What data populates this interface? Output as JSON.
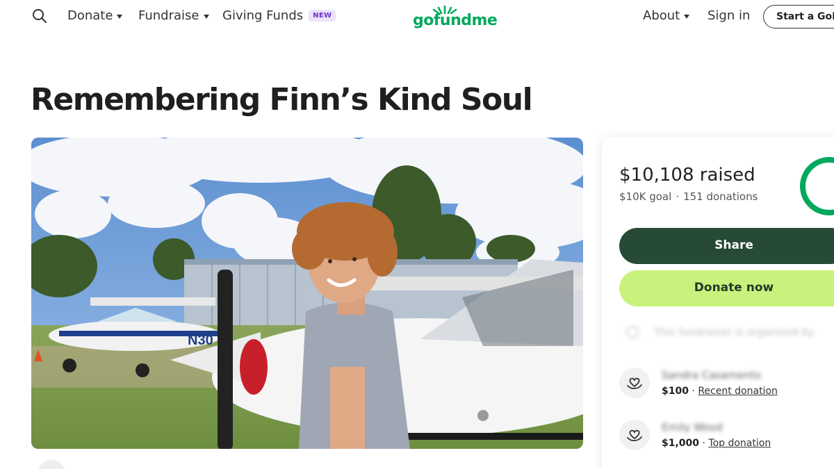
{
  "nav": {
    "donate": "Donate",
    "fundraise": "Fundraise",
    "giving_funds": "Giving Funds",
    "new_badge": "NEW",
    "logo": "gofundme",
    "about": "About",
    "sign_in": "Sign in",
    "start": "Start a GoFundMe"
  },
  "campaign": {
    "title": "Remembering Finn’s Kind Soul",
    "hero_alt": "Smiling young man with curly hair standing in front of small airplanes"
  },
  "donation_card": {
    "raised": "$10,108 raised",
    "goal": "$10K goal",
    "donations": "151 donations",
    "progress_fraction": 1.0,
    "share_label": "Share",
    "donate_label": "Donate now",
    "notice": "This fundraiser is organized by",
    "donors": [
      {
        "name": "Sandra Casamento",
        "amount": "$100",
        "tag": "Recent donation"
      },
      {
        "name": "Emily Wood",
        "amount": "$1,000",
        "tag": "Top donation"
      }
    ]
  },
  "colors": {
    "brand_green": "#02a95c",
    "share_button": "#264a35",
    "donate_button": "#c9f27c",
    "new_badge_bg": "#ece2fb"
  }
}
